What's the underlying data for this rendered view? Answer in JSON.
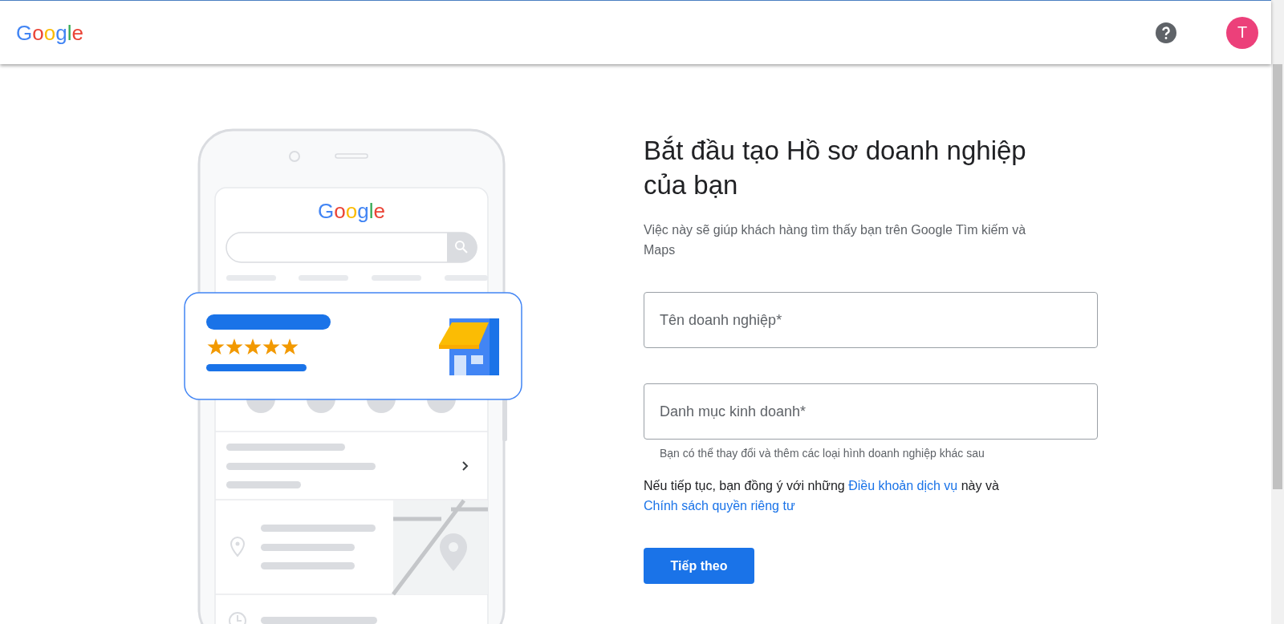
{
  "header": {
    "logo": "Google",
    "avatar": {
      "letter": "T",
      "color": "#ec407a"
    }
  },
  "illustration": {
    "logo": "Google",
    "stars": 5
  },
  "form": {
    "title": "Bắt đầu tạo Hồ sơ doanh nghiệp của bạn",
    "subtitle": "Việc này sẽ giúp khách hàng tìm thấy bạn trên Google Tìm kiếm và Maps",
    "fields": [
      {
        "placeholder": "Tên doanh nghiệp*"
      },
      {
        "placeholder": "Danh mục kinh doanh*",
        "helper": "Bạn có thể thay đổi và thêm các loại hình doanh nghiệp khác sau"
      }
    ],
    "consent": [
      {
        "kind": "text",
        "text": "Nếu tiếp tục, bạn đồng ý với những "
      },
      {
        "kind": "link",
        "text": "Điều khoản dịch vụ"
      },
      {
        "kind": "text",
        "text": " này và "
      },
      {
        "kind": "link",
        "text": "Chính sách quyền riêng tư"
      }
    ],
    "button": "Tiếp theo"
  }
}
